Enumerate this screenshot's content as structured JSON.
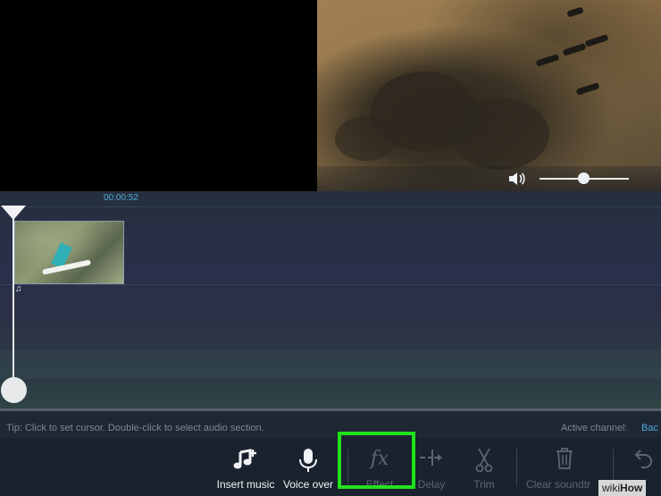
{
  "preview": {
    "volume_icon": "speaker-icon",
    "volume_level": 0.5
  },
  "timeline": {
    "time_label": "00:00:52",
    "audio_icon": "music-note-icon"
  },
  "status": {
    "tip": "Tip: Click to set cursor. Double-click to select audio section.",
    "active_channel_label": "Active channel:",
    "back_label": "Bac"
  },
  "toolbar": {
    "insert_music": "Insert music",
    "voice_over": "Voice over",
    "effect": "Effect",
    "delay": "Delay",
    "trim": "Trim",
    "clear_soundtrack": "Clear soundtr",
    "undo_icon": "undo-icon"
  },
  "watermark": {
    "brand_a": "wiki",
    "brand_b": "How"
  },
  "colors": {
    "accent": "#4da8d8",
    "highlight": "#21e21a"
  }
}
